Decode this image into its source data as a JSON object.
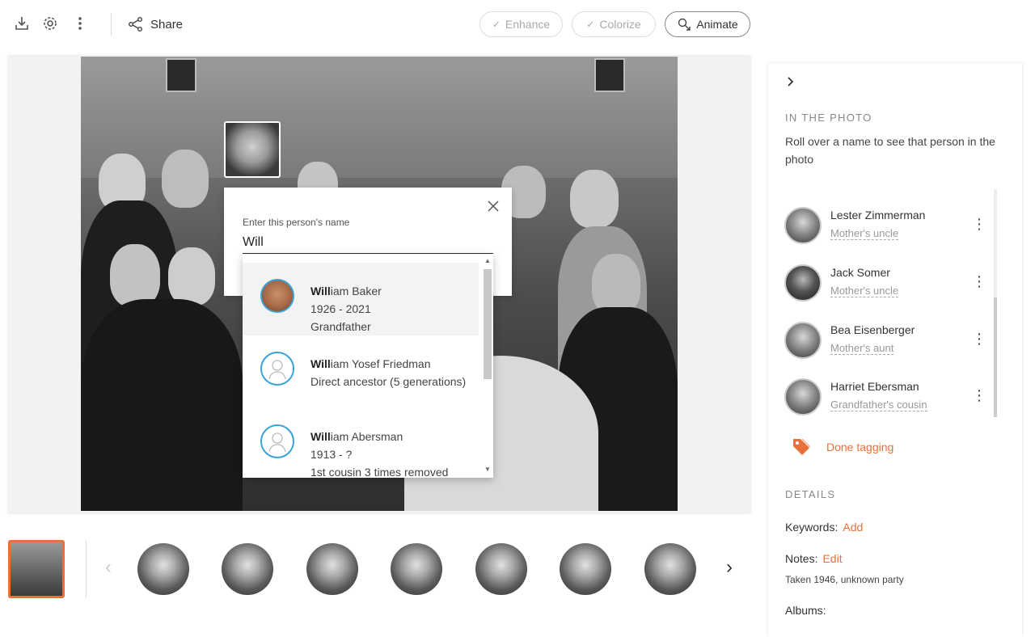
{
  "toolbar": {
    "download_icon": "download-icon",
    "settings_icon": "gear-icon",
    "more_icon": "more-vertical-icon",
    "share_label": "Share",
    "enhance_label": "Enhance",
    "colorize_label": "Colorize",
    "animate_label": "Animate"
  },
  "tag_popup": {
    "label": "Enter this person's name",
    "input_value": "Will"
  },
  "suggestions": [
    {
      "match": "Will",
      "rest": "iam Baker",
      "dates": "1926 - 2021",
      "relation": "Grandfather",
      "avatar": "photo"
    },
    {
      "match": "Will",
      "rest": "iam Yosef Friedman",
      "dates": "",
      "relation": "Direct ancestor (5 generations)",
      "avatar": "placeholder"
    },
    {
      "match": "Will",
      "rest": "iam Abersman",
      "dates": "1913 - ?",
      "relation": "1st cousin 3 times removed",
      "avatar": "placeholder"
    }
  ],
  "panel": {
    "in_photo_heading": "IN THE PHOTO",
    "description": "Roll over a name to see that person in the photo",
    "people": [
      {
        "name": "Lester Zimmerman",
        "relation": "Mother's uncle"
      },
      {
        "name": "Jack Somer",
        "relation": "Mother's uncle"
      },
      {
        "name": "Bea Eisenberger",
        "relation": "Mother's aunt"
      },
      {
        "name": "Harriet Ebersman",
        "relation": "Grandfather's cousin"
      }
    ],
    "done_tagging": "Done tagging",
    "details_heading": "DETAILS",
    "keywords_label": "Keywords:",
    "keywords_action": "Add",
    "notes_label": "Notes:",
    "notes_action": "Edit",
    "notes_text": "Taken 1946, unknown party",
    "albums_label": "Albums:"
  },
  "colors": {
    "accent": "#e8703a",
    "link_blue": "#3aa3d8"
  }
}
